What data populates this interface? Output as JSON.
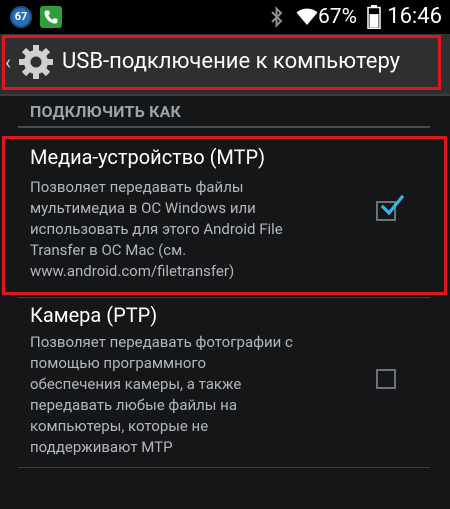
{
  "status_bar": {
    "badge": "67",
    "battery_percent": "67%",
    "time": "16:46",
    "icons": [
      "notification-badge-icon",
      "phone-call-icon",
      "bluetooth-icon",
      "wifi-icon",
      "battery-icon"
    ]
  },
  "action_bar": {
    "title": "USB-подключение к компьютеру",
    "icon": "gear-icon",
    "up_icon": "chevron-left-icon"
  },
  "section": {
    "header": "ПОДКЛЮЧИТЬ КАК"
  },
  "options": [
    {
      "title": "Медиа-устройство (MTP)",
      "summary": "Позволяет передавать файлы\nмультимедиа в ОС Windows или\nиспользовать для этого Android File\nTransfer в ОС Mac (см.\nwww.android.com/filetransfer)",
      "checked": true
    },
    {
      "title": "Камера (PTP)",
      "summary": "Позволяет передавать фотографии с\nпомощью программного\nобеспечения камеры, а также\nпередавать любые файлы на\nкомпьютеры, которые не\nподдерживают MTP",
      "checked": false
    }
  ],
  "colors": {
    "highlight": "#e1151b",
    "check_accent": "#33b5e5",
    "background": "#141618",
    "action_bar": "#2d2f31"
  }
}
